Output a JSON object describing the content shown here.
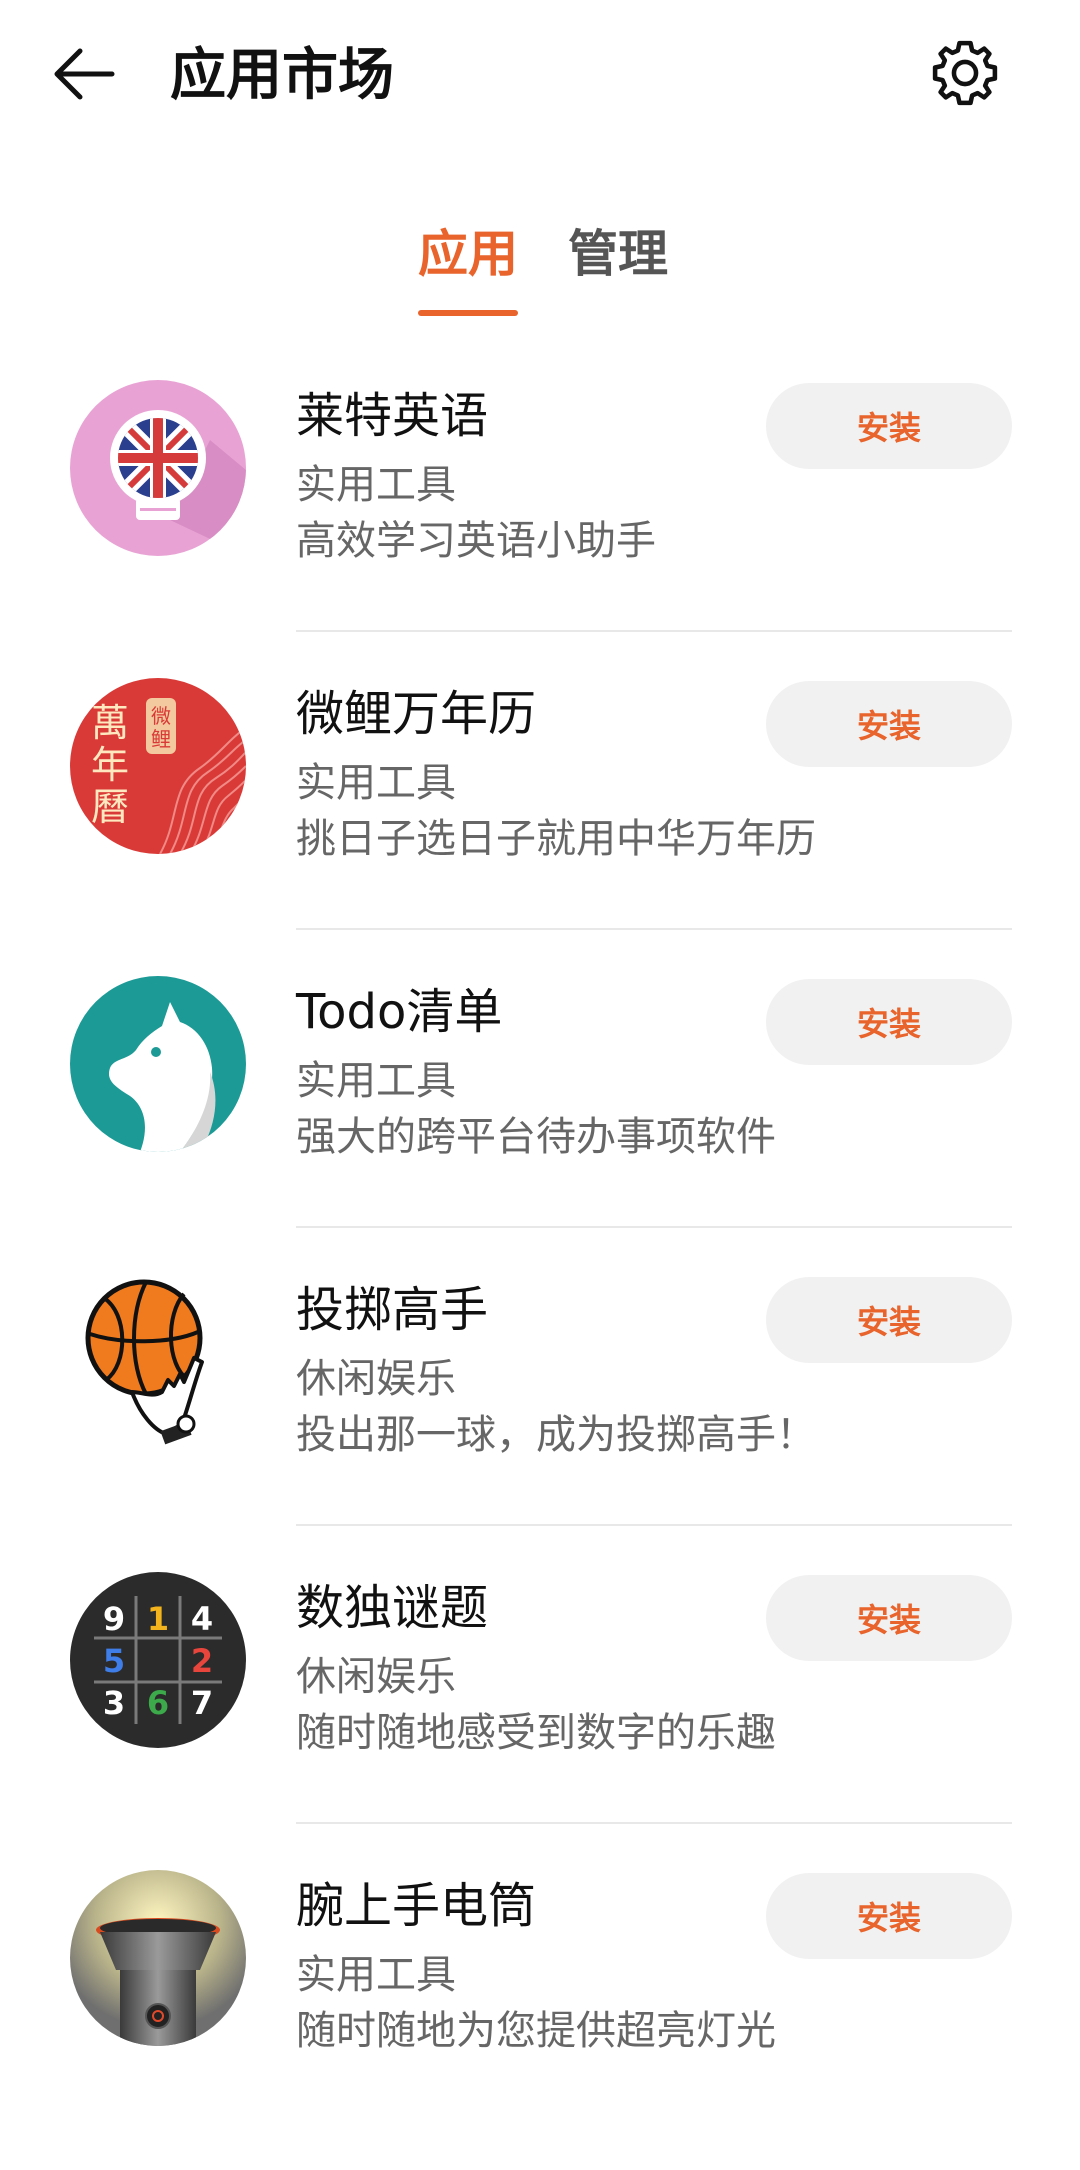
{
  "header": {
    "title": "应用市场",
    "back_icon": "back-arrow-icon",
    "settings_icon": "gear-icon"
  },
  "tabs": [
    {
      "label": "应用",
      "active": true
    },
    {
      "label": "管理",
      "active": false
    }
  ],
  "colors": {
    "accent": "#e8642c",
    "button_bg": "#f1f1f1",
    "secondary_text": "#666666"
  },
  "apps": [
    {
      "name": "莱特英语",
      "category": "实用工具",
      "description": "高效学习英语小助手",
      "button": "安装",
      "icon": "uk-flag-bulb-icon"
    },
    {
      "name": "微鲤万年历",
      "category": "实用工具",
      "description": "挑日子选日子就用中华万年历",
      "button": "安装",
      "icon": "calendar-icon",
      "icon_text": {
        "main": [
          "萬",
          "年",
          "曆"
        ],
        "seal": [
          "微",
          "鲤"
        ]
      }
    },
    {
      "name": "Todo清单",
      "category": "实用工具",
      "description": "强大的跨平台待办事项软件",
      "button": "安装",
      "icon": "horse-icon"
    },
    {
      "name": "投掷高手",
      "category": "休闲娱乐",
      "description": "投出那一球，成为投掷高手！",
      "button": "安装",
      "icon": "basketball-hand-icon"
    },
    {
      "name": "数独谜题",
      "category": "休闲娱乐",
      "description": "随时随地感受到数字的乐趣",
      "button": "安装",
      "icon": "sudoku-icon",
      "icon_text": {
        "digits": [
          "9",
          "1",
          "4",
          "5",
          "2",
          "3",
          "6",
          "7"
        ]
      }
    },
    {
      "name": "腕上手电筒",
      "category": "实用工具",
      "description": "随时随地为您提供超亮灯光",
      "button": "安装",
      "icon": "flashlight-icon"
    }
  ]
}
